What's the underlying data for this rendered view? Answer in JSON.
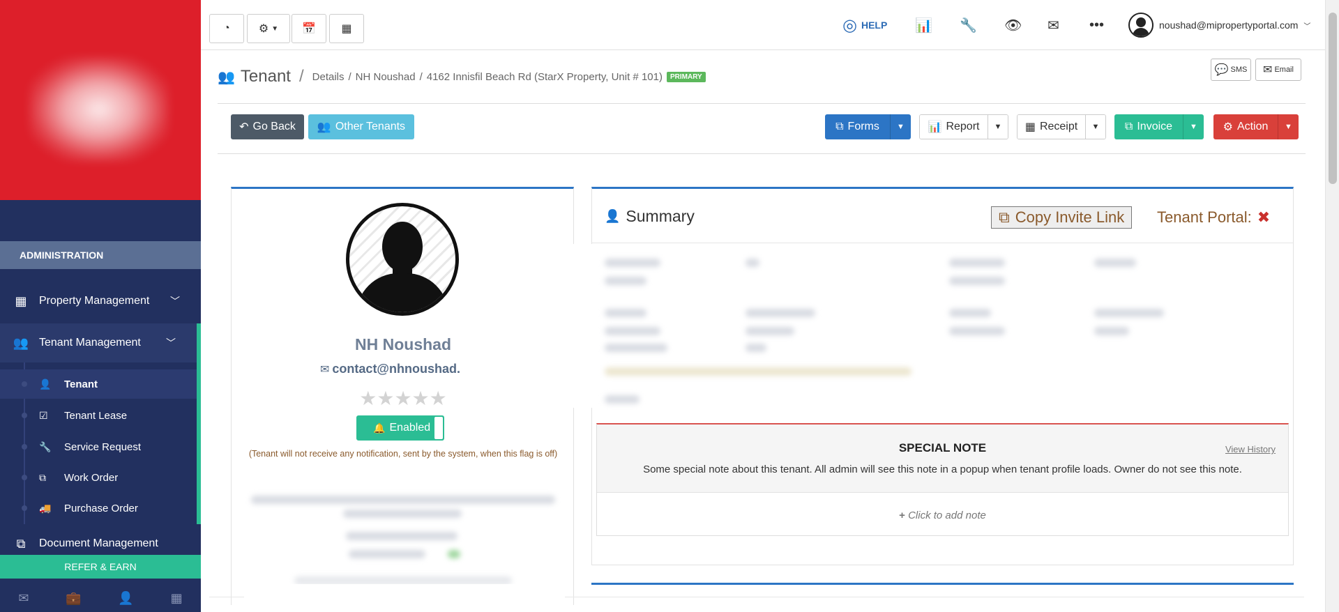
{
  "sidebar": {
    "section_label": "ADMINISTRATION",
    "items": [
      {
        "label": "Property Management",
        "icon": "building-icon"
      },
      {
        "label": "Tenant Management",
        "icon": "users-icon"
      },
      {
        "label": "Document Management",
        "icon": "documents-icon"
      }
    ],
    "sub_items": [
      {
        "label": "Tenant",
        "icon": "user-icon"
      },
      {
        "label": "Tenant Lease",
        "icon": "calendar-check-icon"
      },
      {
        "label": "Service Request",
        "icon": "wrench-icon"
      },
      {
        "label": "Work Order",
        "icon": "copy-icon"
      },
      {
        "label": "Purchase Order",
        "icon": "truck-icon"
      }
    ],
    "refer_label": "REFER & EARN"
  },
  "topbar": {
    "help_label": "HELP",
    "user_email": "noushad@mipropertyportal.com"
  },
  "header": {
    "title": "Tenant",
    "crumb_details": "Details",
    "crumb_tenant": "NH Noushad",
    "crumb_property": "4162 Innisfil Beach Rd (StarX Property, Unit # 101)",
    "badge": "PRIMARY",
    "sms_label": "SMS",
    "email_label": "Email"
  },
  "actions": {
    "go_back": "Go Back",
    "other_tenants": "Other Tenants",
    "forms": "Forms",
    "report": "Report",
    "receipt": "Receipt",
    "invoice": "Invoice",
    "action": "Action"
  },
  "profile": {
    "name": "NH Noushad",
    "email": "contact@nhnoushad.com",
    "stars": "★★★★★",
    "notify_label": "Enabled",
    "notify_note": "(Tenant will not receive any notification, sent by the system, when this flag is off)"
  },
  "summary": {
    "title": "Summary",
    "copy_invite": "Copy Invite Link",
    "portal_label": "Tenant Portal:",
    "note_title": "SPECIAL NOTE",
    "note_history": "View History",
    "note_text": "Some special note about this tenant. All admin will see this note in a popup when tenant profile loads. Owner do not see this note.",
    "note_add": "Click to add note"
  },
  "colors": {
    "sidebar_bg": "#22305f",
    "logo_bg": "#dd1f2a",
    "accent_green": "#2bbd94",
    "accent_blue": "#2c75c5",
    "danger": "#d9403a"
  }
}
